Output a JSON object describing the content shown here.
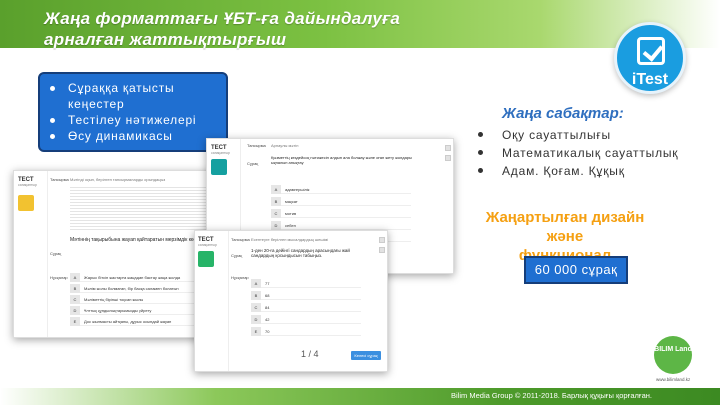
{
  "title": {
    "line1": "Жаңа форматтағы ҰБТ-ға дайындалуға",
    "line2": "арналған жаттықтырғыш"
  },
  "logo": {
    "icon": "check-square-icon",
    "label": "iTest"
  },
  "features": [
    "Сұраққа қатысты кеңестер",
    "Тестілеу нәтижелері",
    "Өсу динамикасы"
  ],
  "lessons": {
    "title": "Жаңа сабақтар:",
    "items": [
      "Оқу сауаттылығы",
      "Математикалық сауаттылық",
      "Адам. Қоғам. Құқық"
    ]
  },
  "design": {
    "line1": "Жаңартылған дизайн және",
    "line2": "функционал"
  },
  "question_count": "60 000 сұрақ",
  "screens": {
    "back": {
      "test_title": "ТЕСТ",
      "sub": "сапақаптыр",
      "task_label": "Тапсырма",
      "question_label": "Сұрақ",
      "answers_label": "Нұсқалар",
      "task_text": "Мәтінді оқып, берілген тапсырмаларды орындаңыз",
      "question": "Мәтіннің тақырыбына жауап қайтаратын мерзімдік көрсеткіш",
      "options": [
        {
          "n": "A",
          "t": "Жарыс бітсін жастарға жаңадан бастау жаңа жолда"
        },
        {
          "n": "B",
          "t": "Мәлім жолы болмаған, бір басқа саламен болатын"
        },
        {
          "n": "C",
          "t": "Мәліметтің бірінші тоқсан жылы"
        },
        {
          "n": "D",
          "t": "Ұлттық құндылықтарымызды үйрету"
        },
        {
          "n": "E",
          "t": "Дос жылмасты айтқаны, дұрыс осындай жауап"
        }
      ]
    },
    "mid": {
      "test_title": "ТЕСТ",
      "sub": "сапақаптыр",
      "task_label": "Тапсырма",
      "question_label": "Сұрақ",
      "task_head": "Арнаулы мәтін",
      "question": "Қызметтің кездейсоқ нәтижесін алдын ала болжау және оған жету жолдары ықпалын анықтау",
      "options": [
        {
          "n": "A",
          "t": "адамгершілік"
        },
        {
          "n": "B",
          "t": "мақсат"
        },
        {
          "n": "C",
          "t": "мотив"
        },
        {
          "n": "D",
          "t": "себеп"
        },
        {
          "n": "E",
          "t": "құндылық"
        }
      ]
    },
    "front": {
      "test_title": "ТЕСТ",
      "sub": "сапақаптыр",
      "task_label": "Тапсырма",
      "question_label": "Сұрақ",
      "answers_label": "Нұсқалар",
      "task_text": "Есептеуге берілген мысалдардың шешімі",
      "question": "1-ден 20-ға дейінгі сандардың арасындағы жай сандардың қосындысын табыңыз.",
      "options": [
        {
          "n": "A",
          "t": "77"
        },
        {
          "n": "B",
          "t": "68"
        },
        {
          "n": "C",
          "t": "84"
        },
        {
          "n": "D",
          "t": "42"
        },
        {
          "n": "E",
          "t": "70"
        }
      ],
      "pager": "1 / 4",
      "next": "Келесі сұрақ"
    }
  },
  "brand": {
    "name": "BILIM Land",
    "url": "www.bilimland.kz"
  },
  "footer": "Bilim Media Group © 2011-2018. Барлық құқығы қорғалған."
}
